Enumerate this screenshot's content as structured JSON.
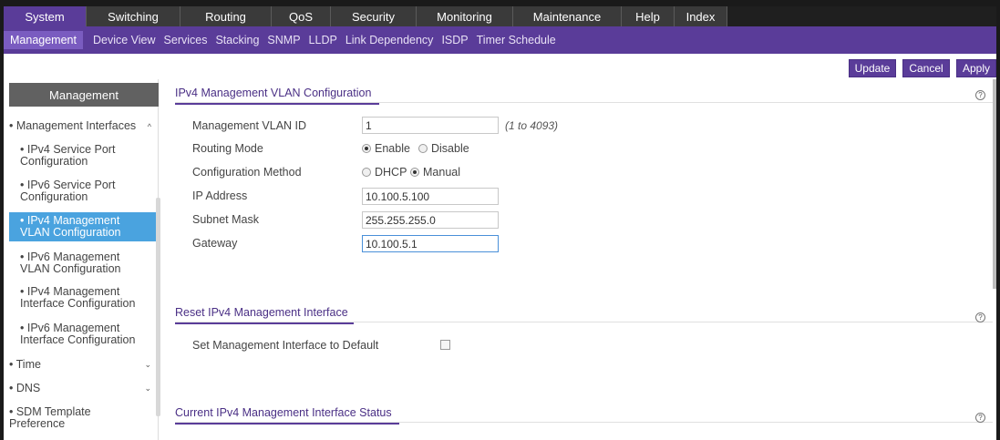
{
  "topnav": {
    "tabs": [
      "System",
      "Switching",
      "Routing",
      "QoS",
      "Security",
      "Monitoring",
      "Maintenance",
      "Help",
      "Index"
    ]
  },
  "subnav": {
    "items": [
      "Management",
      "Device View",
      "Services",
      "Stacking",
      "SNMP",
      "LLDP",
      "Link Dependency",
      "ISDP",
      "Timer Schedule"
    ]
  },
  "actions": {
    "update": "Update",
    "cancel": "Cancel",
    "apply": "Apply"
  },
  "sidebar": {
    "title": "Management",
    "items": [
      {
        "label": "• Management Interfaces",
        "caret": "^"
      },
      {
        "label": "• IPv4 Service Port Configuration"
      },
      {
        "label": "• IPv6 Service Port Configuration"
      },
      {
        "label": "• IPv4 Management VLAN Configuration"
      },
      {
        "label": "• IPv6 Management VLAN Configuration"
      },
      {
        "label": "• IPv4 Management Interface Configuration"
      },
      {
        "label": "• IPv6 Management Interface Configuration"
      },
      {
        "label": "• Time",
        "caret": "⌄"
      },
      {
        "label": "• DNS",
        "caret": "⌄"
      },
      {
        "label": "• SDM Template Preference"
      }
    ]
  },
  "vlan_config": {
    "title": "IPv4 Management VLAN Configuration",
    "fields": {
      "vlan_id_label": "Management VLAN ID",
      "vlan_id_value": "1",
      "vlan_id_hint": "(1 to 4093)",
      "routing_label": "Routing Mode",
      "routing_enable": "Enable",
      "routing_disable": "Disable",
      "method_label": "Configuration Method",
      "method_dhcp": "DHCP",
      "method_manual": "Manual",
      "ip_label": "IP Address",
      "ip_value": "10.100.5.100",
      "mask_label": "Subnet Mask",
      "mask_value": "255.255.255.0",
      "gateway_label": "Gateway",
      "gateway_value": "10.100.5.1"
    }
  },
  "reset": {
    "title": "Reset IPv4 Management Interface",
    "default_label": "Set Management Interface to Default"
  },
  "status": {
    "title": "Current IPv4 Management Interface Status"
  },
  "help_icon": "?",
  "colors": {
    "brand": "#5a3c99",
    "active": "#4aa3df",
    "dark": "#3a3a3a"
  }
}
